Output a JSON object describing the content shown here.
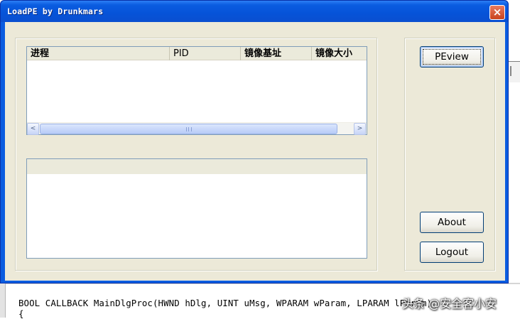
{
  "window": {
    "title": "LoadPE by Drunkmars",
    "close_label": "×"
  },
  "process_list": {
    "columns": [
      "进程",
      "PID",
      "镜像基址",
      "镜像大小"
    ],
    "rows": []
  },
  "scrollbar": {
    "left_arrow": "<",
    "right_arrow": ">"
  },
  "buttons": {
    "peview": "PEview",
    "about": "About",
    "logout": "Logout"
  },
  "code": {
    "line1": "BOOL CALLBACK MainDlgProc(HWND hDlg, UINT uMsg, WPARAM wParam, LPARAM lParam)",
    "line2": "{"
  },
  "watermark": "头条 @安全客小安",
  "colors": {
    "titlebar": "#0a5ce0",
    "client": "#ece9d8",
    "close_button": "#c9431d"
  }
}
